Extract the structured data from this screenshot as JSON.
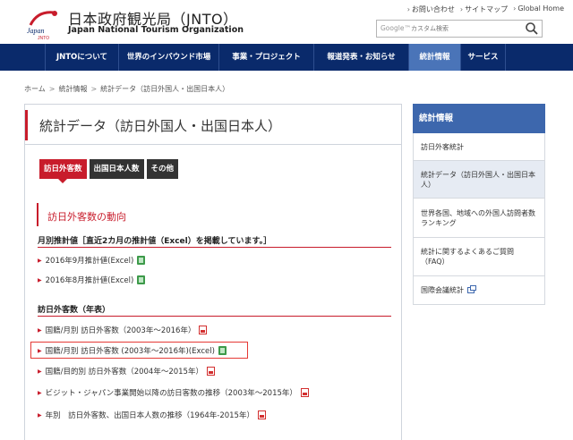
{
  "header": {
    "org_name_jp": "日本政府観光局（JNTO）",
    "org_name_en": "Japan National Tourism Organization",
    "logo_text": "Japan",
    "logo_sub": "JNTO",
    "util_links": [
      "お問い合わせ",
      "サイトマップ",
      "Global Home"
    ],
    "search_brand": "Google™",
    "search_placeholder": "カスタム検索"
  },
  "nav": {
    "items": [
      {
        "label": "JNTOについて",
        "active": false
      },
      {
        "label": "世界のインバウンド市場",
        "active": false
      },
      {
        "label": "事業・プロジェクト",
        "active": false
      },
      {
        "label": "報道発表・お知らせ",
        "active": false
      },
      {
        "label": "統計情報",
        "active": true
      },
      {
        "label": "サービス",
        "active": false
      }
    ]
  },
  "breadcrumb": [
    "ホーム",
    "統計情報",
    "統計データ（訪日外国人・出国日本人）"
  ],
  "main": {
    "title": "統計データ（訪日外国人・出国日本人）",
    "tabs": [
      {
        "label": "訪日外客数",
        "active": true
      },
      {
        "label": "出国日本人数",
        "active": false
      },
      {
        "label": "その他",
        "active": false
      }
    ],
    "section_title": "訪日外客数の動向",
    "monthly": {
      "heading": "月別推計値［直近2カ月の推計値（Excel）を掲載しています。］",
      "links": [
        {
          "label": "2016年9月推計値(Excel)",
          "file": "excel"
        },
        {
          "label": "2016年8月推計値(Excel)",
          "file": "excel"
        }
      ]
    },
    "annual": {
      "heading": "訪日外客数（年表）",
      "links": [
        {
          "label": "国籍/月別 訪日外客数（2003年～2016年）",
          "file": "pdf"
        },
        {
          "label": "国籍/月別 訪日外客数 (2003年～2016年)(Excel)",
          "file": "excel",
          "highlighted": true
        },
        {
          "label": "国籍/目的別 訪日外客数（2004年～2015年）",
          "file": "pdf"
        },
        {
          "label": "ビジット・ジャパン事業開始以降の訪日客数の推移（2003年～2015年）",
          "file": "pdf"
        },
        {
          "label": "年別　訪日外客数、出国日本人数の推移（1964年-2015年）",
          "file": "pdf"
        }
      ]
    }
  },
  "sidebar": {
    "title": "統計情報",
    "items": [
      {
        "label": "訪日外客統計",
        "active": false
      },
      {
        "label": "統計データ（訪日外国人・出国日本人）",
        "active": true
      },
      {
        "label": "世界各国、地域への外国人訪問者数ランキング",
        "active": false
      },
      {
        "label": "統計に関するよくあるご質問（FAQ）",
        "active": false
      },
      {
        "label": "国際会議統計",
        "active": false,
        "external": true
      }
    ]
  },
  "colors": {
    "nav_bg": "#0a2a6b",
    "nav_active": "#4a74b8",
    "accent_red": "#c81c2b",
    "sidebar_head": "#3d67ad"
  }
}
